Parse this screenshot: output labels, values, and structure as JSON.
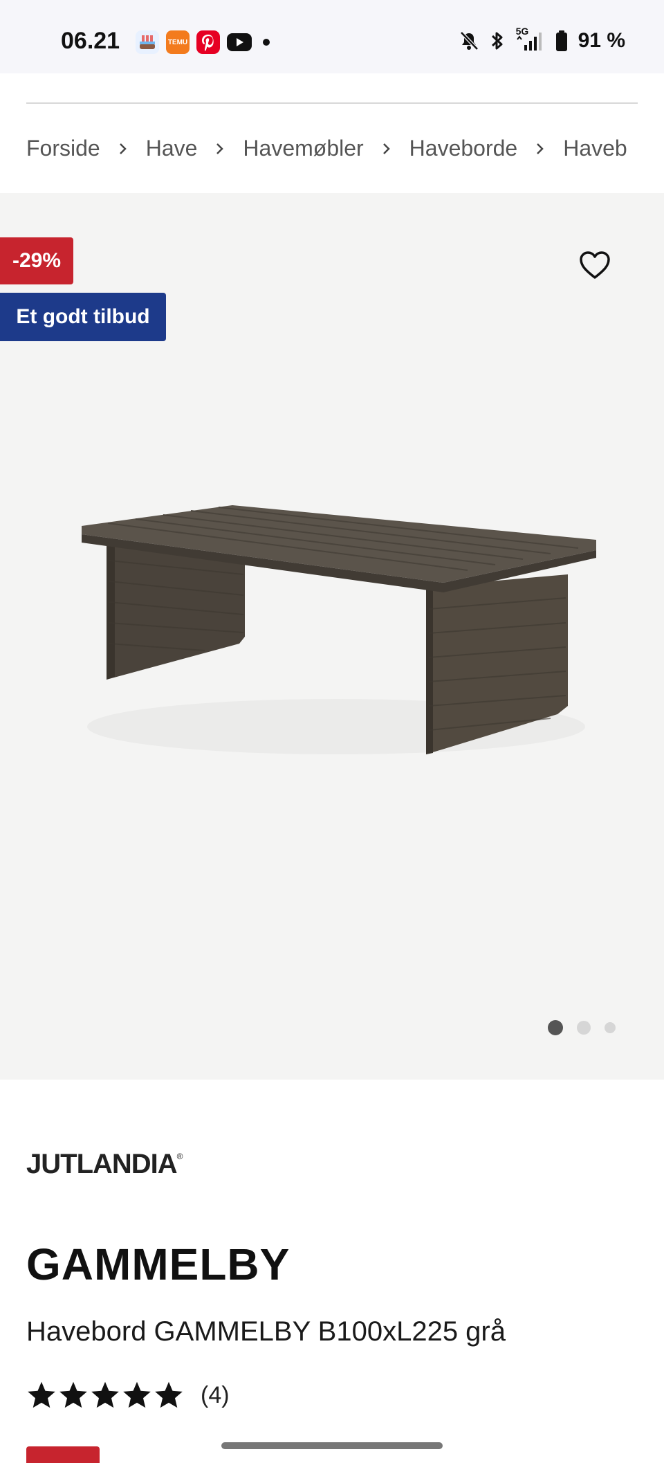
{
  "status_bar": {
    "time": "06.21",
    "battery_text": "91 %",
    "network_label": "5G",
    "apps": [
      "ship-app-icon",
      "temu-app-icon",
      "pinterest-app-icon",
      "youtube-app-icon"
    ],
    "temu_label": "TEMU"
  },
  "breadcrumb": {
    "items": [
      "Forside",
      "Have",
      "Havemøbler",
      "Haveborde",
      "Haveb"
    ]
  },
  "badges": {
    "discount": "-29%",
    "offer": "Et godt tilbud",
    "discount_color": "#c7242e",
    "offer_color": "#1d3a8a"
  },
  "carousel": {
    "total": 3,
    "active_index": 0
  },
  "product": {
    "brand": "JUTLANDIA",
    "brand_mark": "®",
    "title": "GAMMELBY",
    "subtitle": "Havebord GAMMELBY B100xL225 grå",
    "rating_stars": 5,
    "rating_count": "(4)"
  }
}
